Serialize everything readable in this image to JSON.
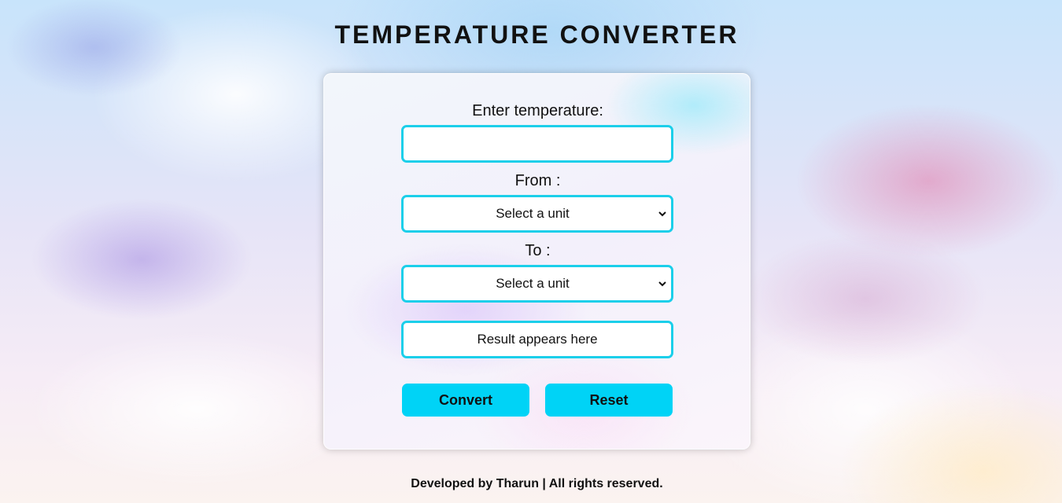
{
  "header": {
    "title": "TEMPERATURE CONVERTER"
  },
  "form": {
    "temperature_label": "Enter temperature:",
    "temperature_value": "",
    "from_label": "From :",
    "from_select": {
      "selected": "Select a unit",
      "icon": "chevron-down-icon"
    },
    "to_label": "To :",
    "to_select": {
      "selected": "Select a unit",
      "icon": "chevron-down-icon"
    },
    "result_text": "Result appears here",
    "convert_label": "Convert",
    "reset_label": "Reset"
  },
  "footer": {
    "text": "Developed by Tharun | All rights reserved."
  },
  "colors": {
    "accent": "#00d3f6",
    "field_border": "#1bcfea",
    "text": "#111111"
  }
}
